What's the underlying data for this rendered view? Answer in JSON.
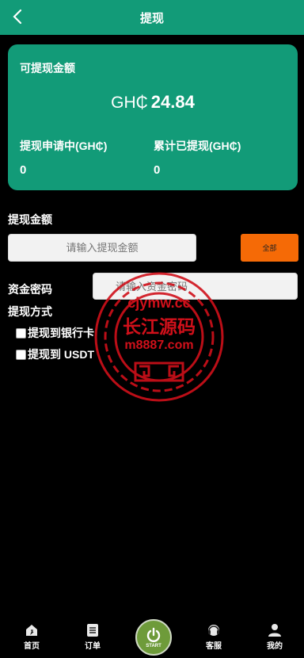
{
  "header": {
    "title": "提现",
    "back_icon": "chevron-left-icon"
  },
  "balance_card": {
    "label": "可提现金额",
    "currency": "GH₵",
    "amount": "24.84",
    "pending_label": "提现申请中(GH₵)",
    "pending_value": "0",
    "withdrawn_label": "累计已提现(GH₵)",
    "withdrawn_value": "0",
    "color": "#129b78"
  },
  "form": {
    "amount_label": "提现金额",
    "amount_placeholder": "请输入提现金额",
    "all_button": "全部",
    "all_button_color": "#f56a06",
    "password_label": "资金密码",
    "password_placeholder": "请输入资金密码",
    "method_label": "提现方式",
    "methods": [
      "提现到银行卡",
      "提现到 USDT"
    ]
  },
  "watermark": {
    "line1": "cjymw.cc",
    "line2": "长江源码",
    "line3": "m8887.com",
    "color": "#d0101a"
  },
  "tabbar": {
    "items": [
      {
        "label": "首页",
        "icon": "home-icon"
      },
      {
        "label": "订单",
        "icon": "order-icon"
      },
      {
        "label": "START",
        "icon": "power-icon"
      },
      {
        "label": "客服",
        "icon": "headset-icon"
      },
      {
        "label": "我的",
        "icon": "user-icon"
      }
    ]
  }
}
